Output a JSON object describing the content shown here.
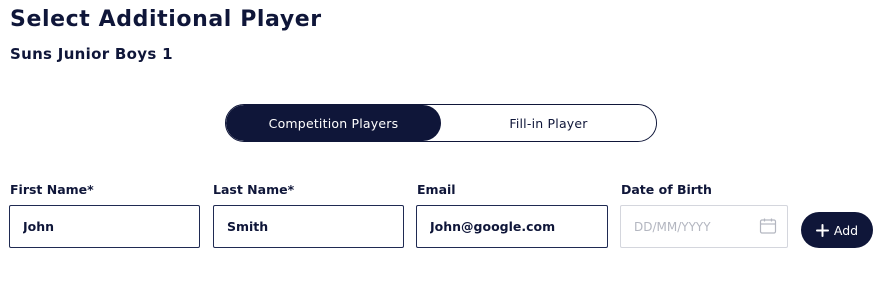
{
  "page": {
    "title": "Select Additional Player",
    "team_name": "Suns Junior Boys 1"
  },
  "player_type_toggle": {
    "options": [
      {
        "label": "Competition Players",
        "selected": true
      },
      {
        "label": "Fill-in Player",
        "selected": false
      }
    ]
  },
  "form": {
    "first_name": {
      "label": "First Name*",
      "value": "John"
    },
    "last_name": {
      "label": "Last Name*",
      "value": "Smith"
    },
    "email": {
      "label": "Email",
      "value": "John@google.com"
    },
    "date_of_birth": {
      "label": "Date of Birth",
      "value": "",
      "placeholder": "DD/MM/YYYY",
      "icon": "calendar-icon"
    },
    "add_button": {
      "label": "Add",
      "icon": "plus-icon"
    }
  },
  "colors": {
    "primary": "#0f1639",
    "input_border": "#1f2a52",
    "disabled_border": "#d4d6dd",
    "placeholder": "#b3b6c0",
    "background": "#ffffff"
  }
}
